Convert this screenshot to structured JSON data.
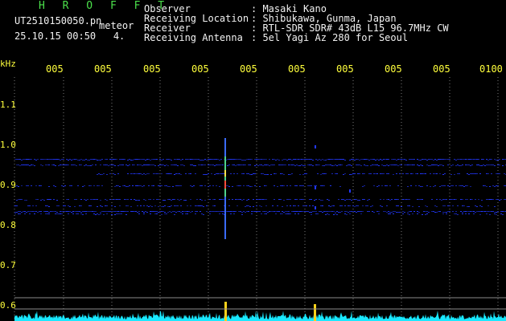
{
  "header": {
    "title": "H R O F F T",
    "filename": "UT2510150050.pn",
    "kind": "meteor",
    "datetime": "25.10.15 00:50   4.",
    "info": [
      {
        "key": "Observer",
        "value": ": Masaki Kano"
      },
      {
        "key": "Receiving Location",
        "value": ": Shibukawa, Gunma, Japan"
      },
      {
        "key": "Receiver",
        "value": ": RTL-SDR SDR# 43dB L15 96.7MHz CW"
      },
      {
        "key": "Receiving Antenna",
        "value": ": 5el Yagi Az 280 for Seoul"
      }
    ]
  },
  "axes": {
    "y_unit": "kHz",
    "x_ticks": [
      "005",
      "005",
      "005",
      "005",
      "005",
      "005",
      "005",
      "005",
      "005",
      "0100"
    ],
    "y_ticks": [
      "1.1",
      "1.0",
      "0.9",
      "0.8",
      "0.7",
      "0.6"
    ]
  },
  "colors": {
    "header_text": "#f2f2f2",
    "title": "#4be04b",
    "axis_labels": "#ffff3c",
    "signal": "#2238ff",
    "baseline_trace": "#19e8ff",
    "grid": "#8c8c8c"
  }
}
